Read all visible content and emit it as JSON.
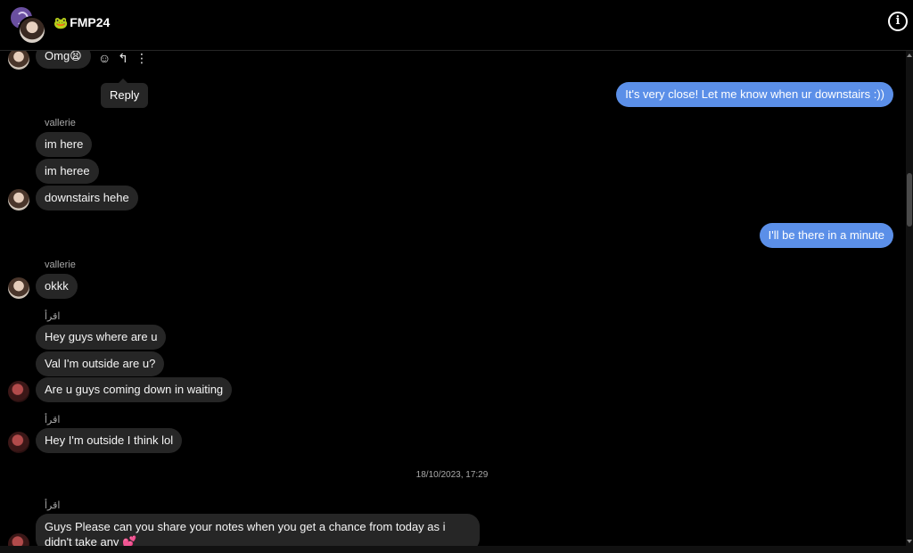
{
  "header": {
    "title_emoji": "🐸",
    "title": "FMP24",
    "info_icon": "info-icon"
  },
  "messages": {
    "omg": "Omg😫",
    "tooltip": "Reply",
    "out1": "It's very close! Let me know when ur downstairs :))",
    "sender_vallerie_1": "vallerie",
    "v1": "im here",
    "v2": "im heree",
    "v3": "downstairs hehe",
    "out2": "I'll be there in a minute",
    "sender_vallerie_2": "vallerie",
    "v4": "okkk",
    "sender_iqra_1": "اقرأ",
    "i1": "Hey guys where are u",
    "i2": "Val I'm outside are u?",
    "i3": "Are u guys coming down in waiting",
    "sender_iqra_2": "اقرأ",
    "i4": "Hey I'm outside I think lol",
    "timestamp": "18/10/2023, 17:29",
    "sender_iqra_3": "اقرأ",
    "i5": "Guys Please can you share your notes when you get a chance from today as i didn't take any 💕"
  },
  "icons": {
    "react": "smiley-icon",
    "reply": "reply-arrow-icon",
    "more": "more-vertical-icon"
  },
  "colors": {
    "background": "#000000",
    "incoming_bubble": "#262626",
    "outgoing_bubble": "#5b8fe8"
  }
}
